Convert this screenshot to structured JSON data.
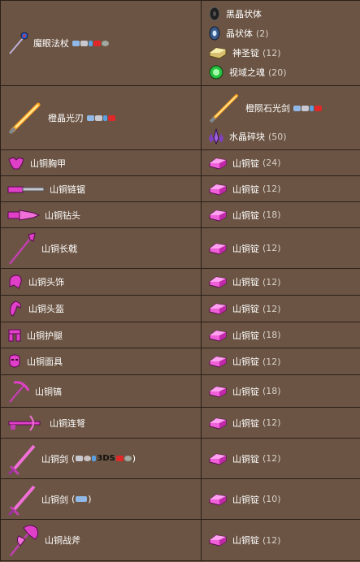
{
  "rows": [
    {
      "result": {
        "name": "魔眼法杖",
        "icon": "staff-icon"
      },
      "ingredients": [
        {
          "name": "黑晶状体",
          "qty": "",
          "icon": "black-lens-icon"
        },
        {
          "name": "晶状体",
          "qty": "(2)",
          "icon": "lens-icon"
        },
        {
          "name": "神圣锭",
          "qty": "(12)",
          "icon": "hallowed-bar-icon"
        },
        {
          "name": "视域之魂",
          "qty": "(20)",
          "icon": "soul-of-sight-icon"
        }
      ]
    },
    {
      "result": {
        "name": "橙晶光刃",
        "icon": "orange-phasesaber-icon"
      },
      "ingredients": [
        {
          "name": "橙陨石光剑",
          "qty": "",
          "icon": "orange-phaseblade-icon"
        },
        {
          "name": "水晶碎块",
          "qty": "(50)",
          "icon": "crystal-shard-icon"
        }
      ]
    },
    {
      "result": {
        "name": "山铜胸甲",
        "icon": "orichalcum-breastplate-icon"
      },
      "ingredients": [
        {
          "name": "山铜锭",
          "qty": "(24)",
          "icon": "orichalcum-bar-icon"
        }
      ]
    },
    {
      "result": {
        "name": "山铜链锯",
        "icon": "orichalcum-chainsaw-icon"
      },
      "ingredients": [
        {
          "name": "山铜锭",
          "qty": "(12)",
          "icon": "orichalcum-bar-icon"
        }
      ]
    },
    {
      "result": {
        "name": "山铜钻头",
        "icon": "orichalcum-drill-icon"
      },
      "ingredients": [
        {
          "name": "山铜锭",
          "qty": "(18)",
          "icon": "orichalcum-bar-icon"
        }
      ]
    },
    {
      "result": {
        "name": "山铜长戟",
        "icon": "orichalcum-halberd-icon"
      },
      "ingredients": [
        {
          "name": "山铜锭",
          "qty": "(12)",
          "icon": "orichalcum-bar-icon"
        }
      ]
    },
    {
      "result": {
        "name": "山铜头饰",
        "icon": "orichalcum-headgear-icon"
      },
      "ingredients": [
        {
          "name": "山铜锭",
          "qty": "(12)",
          "icon": "orichalcum-bar-icon"
        }
      ]
    },
    {
      "result": {
        "name": "山铜头盔",
        "icon": "orichalcum-helmet-icon"
      },
      "ingredients": [
        {
          "name": "山铜锭",
          "qty": "(12)",
          "icon": "orichalcum-bar-icon"
        }
      ]
    },
    {
      "result": {
        "name": "山铜护腿",
        "icon": "orichalcum-leggings-icon"
      },
      "ingredients": [
        {
          "name": "山铜锭",
          "qty": "(18)",
          "icon": "orichalcum-bar-icon"
        }
      ]
    },
    {
      "result": {
        "name": "山铜面具",
        "icon": "orichalcum-mask-icon"
      },
      "ingredients": [
        {
          "name": "山铜锭",
          "qty": "(12)",
          "icon": "orichalcum-bar-icon"
        }
      ]
    },
    {
      "result": {
        "name": "山铜镐",
        "icon": "orichalcum-pickaxe-icon"
      },
      "ingredients": [
        {
          "name": "山铜锭",
          "qty": "(18)",
          "icon": "orichalcum-bar-icon"
        }
      ]
    },
    {
      "result": {
        "name": "山铜连弩",
        "icon": "orichalcum-repeater-icon"
      },
      "ingredients": [
        {
          "name": "山铜锭",
          "qty": "(12)",
          "icon": "orichalcum-bar-icon"
        }
      ]
    },
    {
      "result": {
        "name": "山铜剑",
        "icon": "orichalcum-sword-icon",
        "platforms_open": "(",
        "platforms_close": ")",
        "ds_label": "3DS"
      },
      "ingredients": [
        {
          "name": "山铜锭",
          "qty": "(12)",
          "icon": "orichalcum-bar-icon"
        }
      ]
    },
    {
      "result": {
        "name": "山铜剑",
        "icon": "orichalcum-sword-icon",
        "platforms_open": "(",
        "platforms_close": ")"
      },
      "ingredients": [
        {
          "name": "山铜锭",
          "qty": "(10)",
          "icon": "orichalcum-bar-icon"
        }
      ]
    },
    {
      "result": {
        "name": "山铜战斧",
        "icon": "orichalcum-waraxe-icon"
      },
      "ingredients": [
        {
          "name": "山铜锭",
          "qty": "(12)",
          "icon": "orichalcum-bar-icon"
        }
      ]
    }
  ],
  "colors": {
    "background": "#6b5443",
    "border": "#2a1f18",
    "orichalcum": "#e040c8",
    "text": "#ffffff",
    "qty": "#d8d0c8"
  }
}
